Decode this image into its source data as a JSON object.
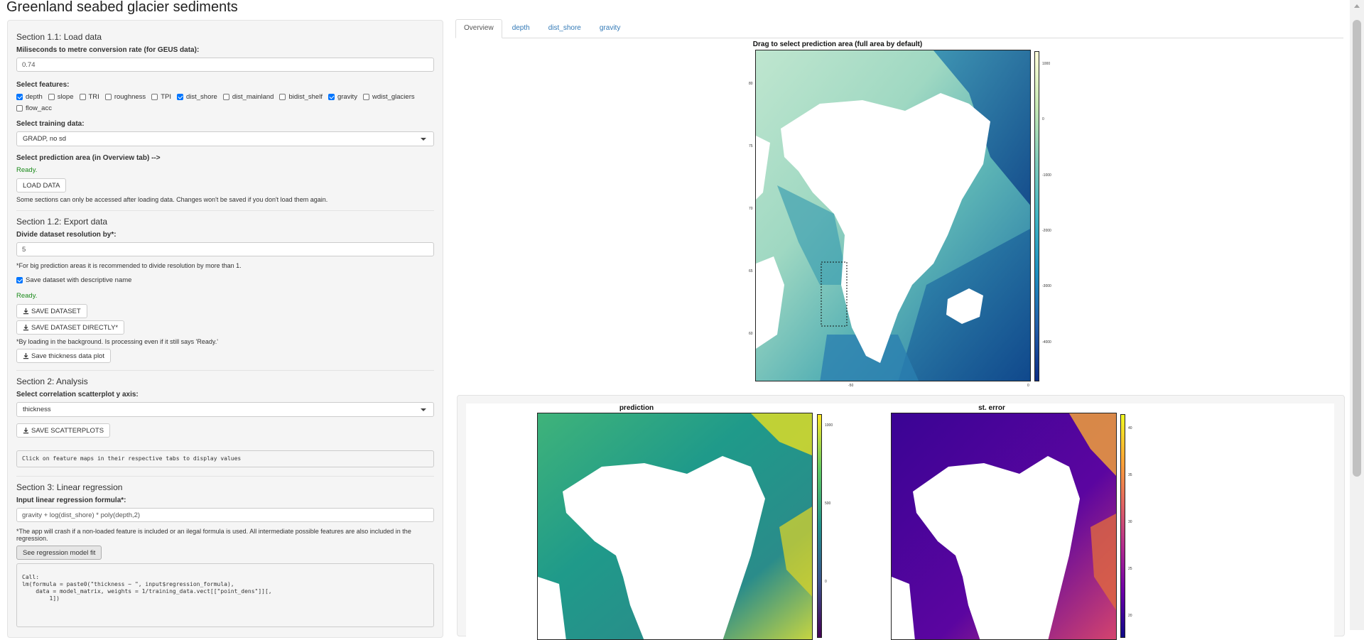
{
  "app": {
    "title": "Greenland seabed glacier sediments"
  },
  "sidebar": {
    "s11": {
      "title": "Section 1.1: Load data",
      "ms_label": "Miliseconds to metre conversion rate (for GEUS data):",
      "ms_value": "0.74",
      "features_label": "Select features:",
      "features": [
        {
          "label": "depth",
          "checked": true
        },
        {
          "label": "slope",
          "checked": false
        },
        {
          "label": "TRI",
          "checked": false
        },
        {
          "label": "roughness",
          "checked": false
        },
        {
          "label": "TPI",
          "checked": false
        },
        {
          "label": "dist_shore",
          "checked": true
        },
        {
          "label": "dist_mainland",
          "checked": false
        },
        {
          "label": "bidist_shelf",
          "checked": false
        },
        {
          "label": "gravity",
          "checked": true
        },
        {
          "label": "wdist_glaciers",
          "checked": false
        },
        {
          "label": "flow_acc",
          "checked": false
        }
      ],
      "training_label": "Select training data:",
      "training_value": "GRADP, no sd",
      "pred_area_label": "Select prediction area (in Overview tab) -->",
      "status": "Ready.",
      "load_button": "LOAD DATA",
      "note": "Some sections can only be accessed after loading data. Changes won't be saved if you don't load them again."
    },
    "s12": {
      "title": "Section 1.2: Export data",
      "divide_label": "Divide dataset resolution by*:",
      "divide_value": "5",
      "divide_note": "*For big prediction areas it is recommended to divide resolution by more than 1.",
      "save_descriptive_label": "Save dataset with descriptive name",
      "save_descriptive_checked": true,
      "status": "Ready.",
      "save_dataset_button": "SAVE DATASET",
      "save_directly_button": "SAVE DATASET DIRECTLY*",
      "loading_note": "*By loading in the background. Is processing even if it still says 'Ready.'",
      "save_thickness_button": "Save thickness data plot"
    },
    "s2": {
      "title": "Section 2: Analysis",
      "yaxis_label": "Select correlation scatterplot y axis:",
      "yaxis_value": "thickness",
      "save_scatter_button": "SAVE SCATTERPLOTS",
      "info_text": "Click on feature maps in their respective tabs to display values"
    },
    "s3": {
      "title": "Section 3: Linear regression",
      "formula_label": "Input linear regression formula*:",
      "formula_value": "gravity + log(dist_shore) * poly(depth,2)",
      "formula_note": "*The app will crash if a non-loaded feature is included or an ilegal formula is used. All intermediate possible features are also included in the regression.",
      "fit_button": "See regression model fit",
      "code_output": "Call:\nlm(formula = paste0(\"thickness ~ \", input$regression_formula),\n    data = model_matrix, weights = 1/training_data.vect[[\"point_dens\"]][,\n        1])"
    }
  },
  "tabs": [
    {
      "label": "Overview",
      "active": true
    },
    {
      "label": "depth",
      "active": false
    },
    {
      "label": "dist_shore",
      "active": false
    },
    {
      "label": "gravity",
      "active": false
    }
  ],
  "overview_map": {
    "title": "Drag to select prediction area (full area by default)",
    "colorbar_ticks": [
      "1000",
      "0",
      "-1000",
      "-2000",
      "-3000",
      "-4000"
    ],
    "x_ticks": [
      "-50",
      "0"
    ],
    "y_ticks": [
      "80",
      "75",
      "70",
      "65",
      "60"
    ]
  },
  "prediction_map": {
    "title": "prediction",
    "colorbar_ticks": [
      "1000",
      "500",
      "0"
    ]
  },
  "error_map": {
    "title": "st. error",
    "colorbar_ticks": [
      "40",
      "35",
      "30",
      "25",
      "20"
    ]
  },
  "colors": {
    "ready_green": "#1a8a1a",
    "link_blue": "#337ab7",
    "checkbox_blue": "#0075ff"
  }
}
